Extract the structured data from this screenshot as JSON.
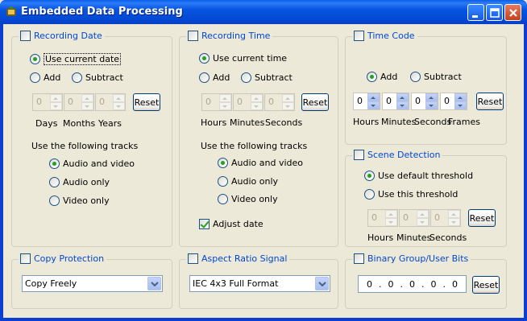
{
  "window": {
    "title": "Embedded Data Processing"
  },
  "recording_date": {
    "label": "Recording Date",
    "checked": false,
    "use_current": "Use current date",
    "add": "Add",
    "subtract": "Subtract",
    "fields": [
      "0",
      "0",
      "0"
    ],
    "field_labels": [
      "Days",
      "Months",
      "Years"
    ],
    "reset": "Reset",
    "tracks_label": "Use the following tracks",
    "tracks": [
      "Audio and video",
      "Audio only",
      "Video only"
    ]
  },
  "recording_time": {
    "label": "Recording Time",
    "checked": false,
    "use_current": "Use current time",
    "add": "Add",
    "subtract": "Subtract",
    "fields": [
      "0",
      "0",
      "0"
    ],
    "field_labels": [
      "Hours",
      "Minutes",
      "Seconds"
    ],
    "reset": "Reset",
    "tracks_label": "Use the following tracks",
    "tracks": [
      "Audio and video",
      "Audio only",
      "Video only"
    ],
    "adjust_date": "Adjust date"
  },
  "time_code": {
    "label": "Time Code",
    "checked": false,
    "add": "Add",
    "subtract": "Subtract",
    "fields": [
      "0",
      "0",
      "0",
      "0"
    ],
    "field_labels": [
      "Hours",
      "Minutes",
      "Seconds",
      "Frames"
    ],
    "reset": "Reset"
  },
  "scene_detection": {
    "label": "Scene Detection",
    "checked": false,
    "default_threshold": "Use default threshold",
    "this_threshold": "Use this threshold",
    "fields": [
      "0",
      "0",
      "0"
    ],
    "field_labels": [
      "Hours",
      "Minutes",
      "Seconds"
    ],
    "reset": "Reset"
  },
  "copy_protection": {
    "label": "Copy Protection",
    "checked": false,
    "selected": "Copy Freely"
  },
  "aspect_ratio": {
    "label": "Aspect Ratio Signal",
    "checked": false,
    "selected": "IEC 4x3 Full Format"
  },
  "binary_group": {
    "label": "Binary Group/User Bits",
    "checked": false,
    "octets": [
      "0",
      "0",
      "0",
      "0",
      "0"
    ],
    "separator": ".",
    "reset": "Reset"
  },
  "colors": {
    "legend": "#0046d5",
    "titlebar": "#0754e0",
    "face": "#ece9d8"
  }
}
